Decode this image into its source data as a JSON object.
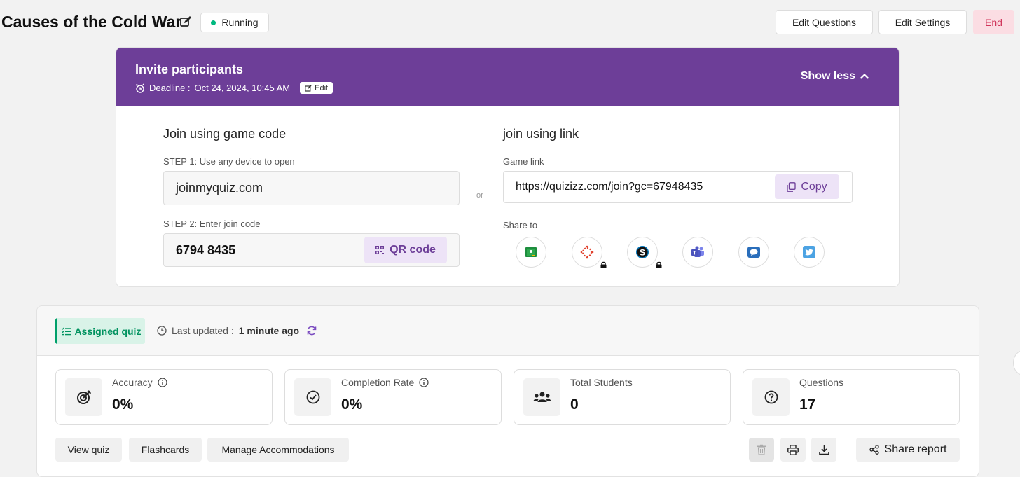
{
  "header": {
    "title": "Causes of the Cold War",
    "status": "Running",
    "colors": {
      "status_dot": "#00b980",
      "end_bg": "#fbdde3",
      "end_text": "#d0355a"
    },
    "buttons": {
      "edit_questions": "Edit Questions",
      "edit_settings": "Edit Settings",
      "end": "End"
    }
  },
  "invite": {
    "title": "Invite participants",
    "deadline_label": "Deadline :",
    "deadline_value": "Oct 24, 2024, 10:45 AM",
    "edit_label": "Edit",
    "toggle_label": "Show less",
    "colors": {
      "header_bg": "#6d3e98",
      "accent_chip_bg": "#ede3f7"
    },
    "code_section": {
      "heading": "Join using game code",
      "step1": "STEP 1: Use any device to open",
      "site": "joinmyquiz.com",
      "step2": "STEP 2: Enter join code",
      "code": "6794 8435",
      "qr_label": "QR code"
    },
    "divider_text": "or",
    "link_section": {
      "heading": "join using link",
      "link_label": "Game link",
      "link": "https://quizizz.com/join?gc=67948435",
      "copy_label": "Copy",
      "share_label": "Share to",
      "share_targets": [
        {
          "icon": "google-classroom-icon",
          "locked": false
        },
        {
          "icon": "canvas-icon",
          "locked": true
        },
        {
          "icon": "schoology-icon",
          "locked": true
        },
        {
          "icon": "microsoft-teams-icon",
          "locked": false
        },
        {
          "icon": "remind-icon",
          "locked": false
        },
        {
          "icon": "twitter-icon",
          "locked": false
        }
      ]
    }
  },
  "report": {
    "chip_label": "Assigned quiz",
    "updated_label": "Last updated :",
    "updated_value": "1 minute ago",
    "colors": {
      "chip_bg": "#d9f3e8",
      "chip_text": "#00925f"
    },
    "stats": [
      {
        "label": "Accuracy",
        "value": "0%",
        "icon": "target-icon",
        "info": true
      },
      {
        "label": "Completion Rate",
        "value": "0%",
        "icon": "check-circle-icon",
        "info": true
      },
      {
        "label": "Total Students",
        "value": "0",
        "icon": "users-icon",
        "info": false
      },
      {
        "label": "Questions",
        "value": "17",
        "icon": "question-circle-icon",
        "info": false
      }
    ],
    "actions": {
      "view_quiz": "View quiz",
      "flashcards": "Flashcards",
      "manage_accommodations": "Manage Accommodations",
      "share_report": "Share report"
    }
  }
}
